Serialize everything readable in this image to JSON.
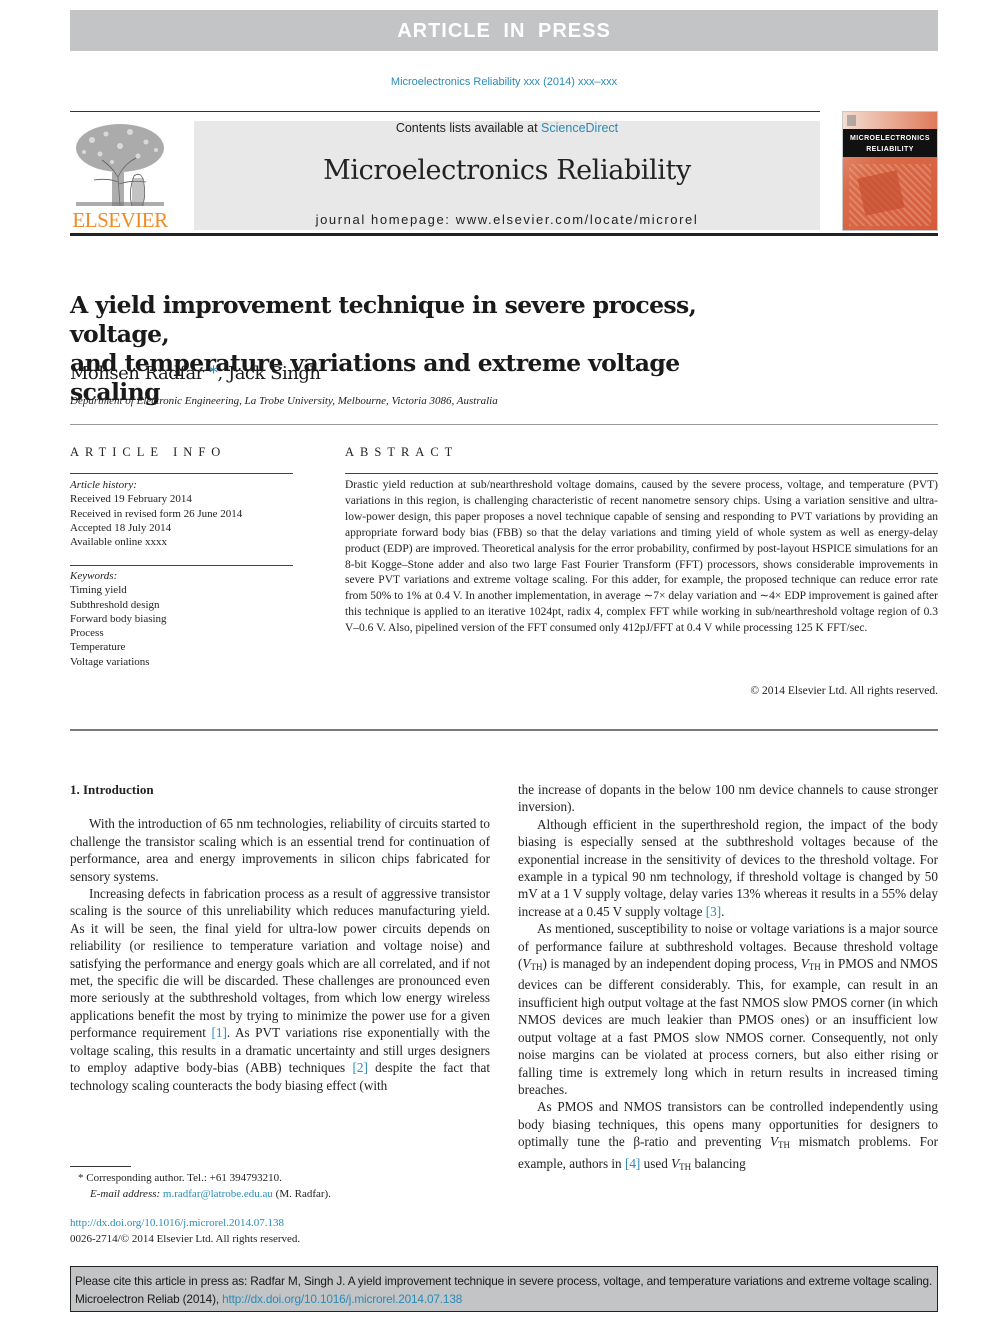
{
  "banner": {
    "text": "ARTICLE IN PRESS"
  },
  "journal_ref": "Microelectronics Reliability xxx (2014) xxx–xxx",
  "header": {
    "publisher_logo_text": "ELSEVIER",
    "contents_prefix": "Contents lists available at ",
    "contents_link": "ScienceDirect",
    "journal_name": "Microelectronics Reliability",
    "homepage_label": "journal homepage: ",
    "homepage_url": "www.elsevier.com/locate/microrel",
    "cover_title_line1": "MICROELECTRONICS",
    "cover_title_line2": "RELIABILITY"
  },
  "article": {
    "title_line1": "A yield improvement technique in severe process, voltage,",
    "title_line2": "and temperature variations and extreme voltage scaling",
    "author1": "Mohsen Radfar",
    "author1_mark": "*",
    "author_sep": ", ",
    "author2": "Jack Singh",
    "affiliation": "Department of Electronic Engineering, La Trobe University, Melbourne, Victoria 3086, Australia"
  },
  "article_info": {
    "heading": "ARTICLE INFO",
    "history_label": "Article history:",
    "history": [
      "Received 19 February 2014",
      "Received in revised form 26 June 2014",
      "Accepted 18 July 2014",
      "Available online xxxx"
    ],
    "keywords_label": "Keywords:",
    "keywords": [
      "Timing yield",
      "Subthreshold design",
      "Forward body biasing",
      "Process",
      "Temperature",
      "Voltage variations"
    ]
  },
  "abstract": {
    "heading": "ABSTRACT",
    "text": "Drastic yield reduction at sub/nearthreshold voltage domains, caused by the severe process, voltage, and temperature (PVT) variations in this region, is challenging characteristic of recent nanometre sensory chips. Using a variation sensitive and ultra-low-power design, this paper proposes a novel technique capable of sensing and responding to PVT variations by providing an appropriate forward body bias (FBB) so that the delay variations and timing yield of whole system as well as energy-delay product (EDP) are improved. Theoretical analysis for the error probability, confirmed by post-layout HSPICE simulations for an 8-bit Kogge–Stone adder and also two large Fast Fourier Transform (FFT) processors, shows considerable improvements in severe PVT variations and extreme voltage scaling. For this adder, for example, the proposed technique can reduce error rate from 50% to 1% at 0.4 V. In another implementation, in average ∼7× delay variation and ∼4× EDP improvement is gained after this technique is applied to an iterative 1024pt, radix 4, complex FFT while working in sub/nearthreshold voltage region of 0.3 V–0.6 V. Also, pipelined version of the FFT consumed only 412pJ/FFT at 0.4 V while processing 125 K FFT/sec.",
    "copyright": "© 2014 Elsevier Ltd. All rights reserved."
  },
  "body": {
    "section_title": "1. Introduction",
    "left": {
      "p1": "With the introduction of 65 nm technologies, reliability of circuits started to challenge the transistor scaling which is an essential trend for continuation of performance, area and energy improvements in silicon chips fabricated for sensory systems.",
      "p2_a": "Increasing defects in fabrication process as a result of aggressive transistor scaling is the source of this unreliability which reduces manufacturing yield. As it will be seen, the final yield for ultra-low power circuits depends on reliability (or resilience to temperature variation and voltage noise) and satisfying the performance and energy goals which are all correlated, and if not met, the specific die will be discarded. These challenges are pronounced even more seriously at the subthreshold voltages, from which low energy wireless applications benefit the most by trying to minimize the power use for a given performance requirement ",
      "ref1": "[1]",
      "p2_b": ". As PVT variations rise exponentially with the voltage scaling, this results in a dramatic uncertainty and still urges designers to employ adaptive body-bias (ABB) techniques ",
      "ref2": "[2]",
      "p2_c": " despite the fact that technology scaling counteracts the body biasing effect (with"
    },
    "right": {
      "p0": "the increase of dopants in the below 100 nm device channels to cause stronger inversion).",
      "p1_a": "Although efficient in the superthreshold region, the impact of the body biasing is especially sensed at the subthreshold voltages because of the exponential increase in the sensitivity of devices to the threshold voltage. For example in a typical 90 nm technology, if threshold voltage is changed by 50 mV at a 1 V supply voltage, delay varies 13% whereas it results in a 55% delay increase at a 0.45 V supply voltage ",
      "ref3": "[3]",
      "p1_b": ".",
      "p2_a": "As mentioned, susceptibility to noise or voltage variations is a major source of performance failure at subthreshold voltages. Because threshold voltage (",
      "vth_v": "V",
      "vth_sub": "TH",
      "p2_b": ") is managed by an independent doping process, ",
      "p2_c": " in PMOS and NMOS devices can be different considerably. This, for example, can result in an insufficient high output voltage at the fast NMOS slow PMOS corner (in which NMOS devices are much leakier than PMOS ones) or an insufficient low output voltage at a fast PMOS slow NMOS corner. Consequently, not only noise margins can be violated at process corners, but also either rising or falling time is extremely long which in return results in increased timing breaches.",
      "p3_a": "As PMOS and NMOS transistors can be controlled independently using body biasing techniques, this opens many opportunities for designers to optimally tune the β-ratio and preventing ",
      "p3_b": " mismatch problems. For example, authors in ",
      "ref4": "[4]",
      "p3_c": " used ",
      "p3_d": " balancing"
    }
  },
  "footnote": {
    "mark": "*",
    "corresponding": " Corresponding author. Tel.: +61 394793210.",
    "email_label": "E-mail address: ",
    "email": "m.radfar@latrobe.edu.au",
    "email_suffix": " (M. Radfar)."
  },
  "doi": {
    "url": "http://dx.doi.org/10.1016/j.microrel.2014.07.138",
    "issn_line": "0026-2714/© 2014 Elsevier Ltd. All rights reserved."
  },
  "citation_box": {
    "text": "Please cite this article in press as: Radfar M, Singh J. A yield improvement technique in severe process, voltage, and temperature variations and extreme voltage scaling. Microelectron Reliab (2014), ",
    "link": "http://dx.doi.org/10.1016/j.microrel.2014.07.138"
  }
}
